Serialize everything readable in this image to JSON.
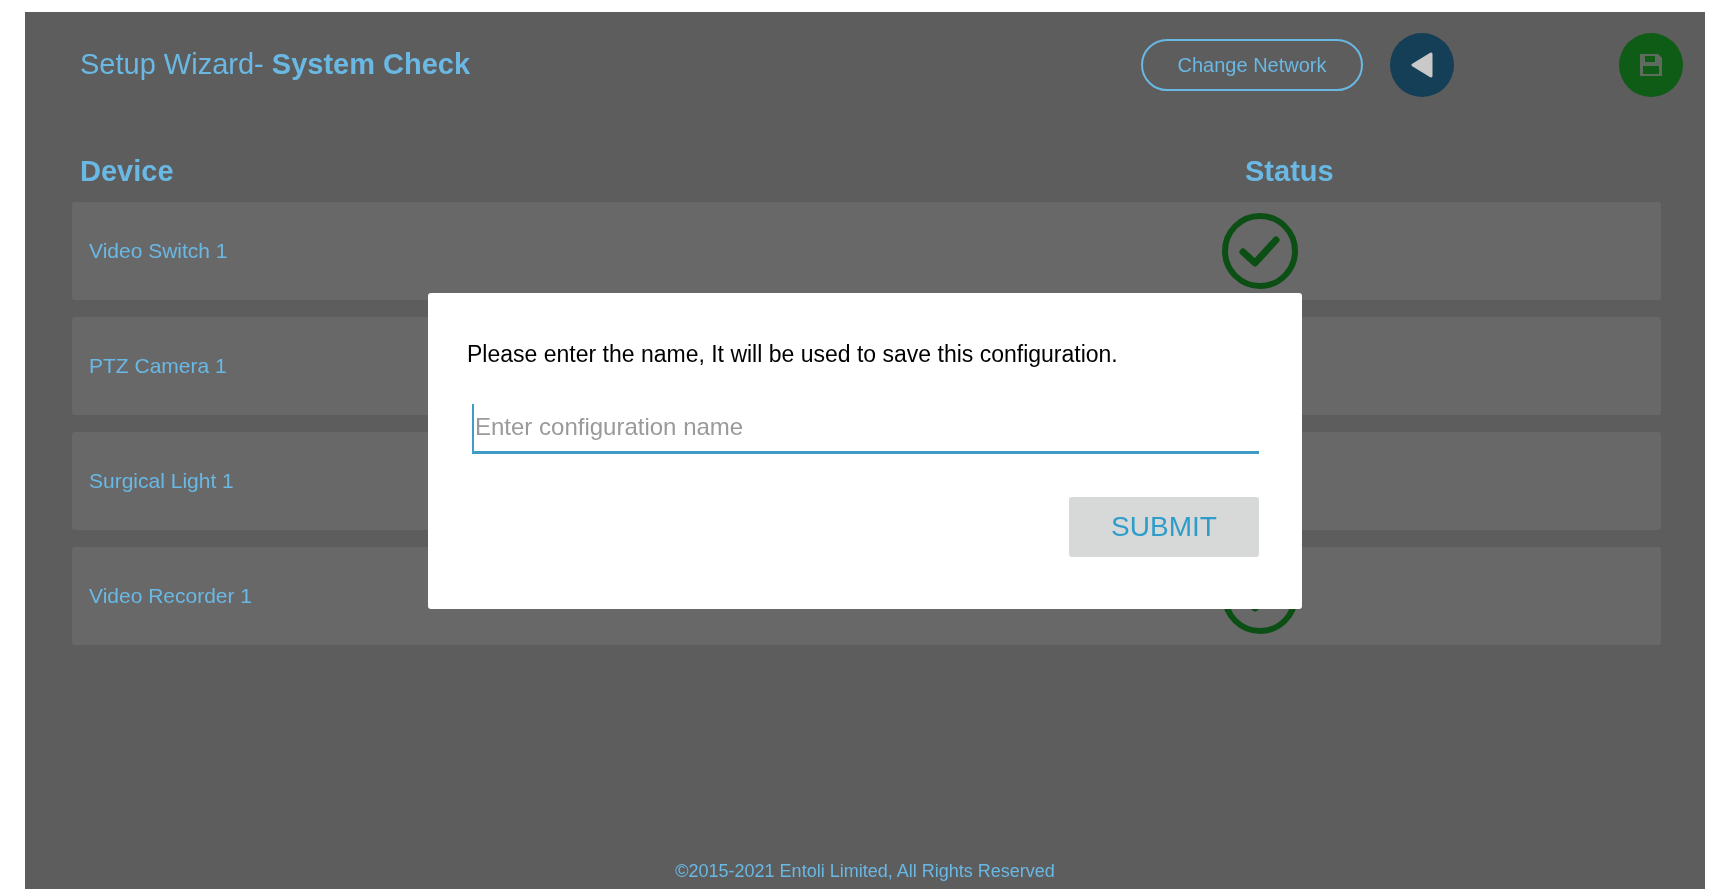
{
  "header": {
    "title_prefix": "Setup Wizard- ",
    "title_bold": "System Check",
    "change_network": "Change Network"
  },
  "table": {
    "columns": [
      "Device",
      "Status"
    ],
    "rows": [
      {
        "device": "Video Switch 1",
        "status_ok": true
      },
      {
        "device": "PTZ Camera 1"
      },
      {
        "device": "Surgical Light 1"
      },
      {
        "device": "Video Recorder 1",
        "status_ok": true
      }
    ]
  },
  "dialog": {
    "message": "Please enter the name, It will be used to save this configuration.",
    "placeholder": "Enter configuration name",
    "submit": "SUBMIT"
  },
  "footer": "©2015-2021 Entoli Limited, All Rights Reserved"
}
